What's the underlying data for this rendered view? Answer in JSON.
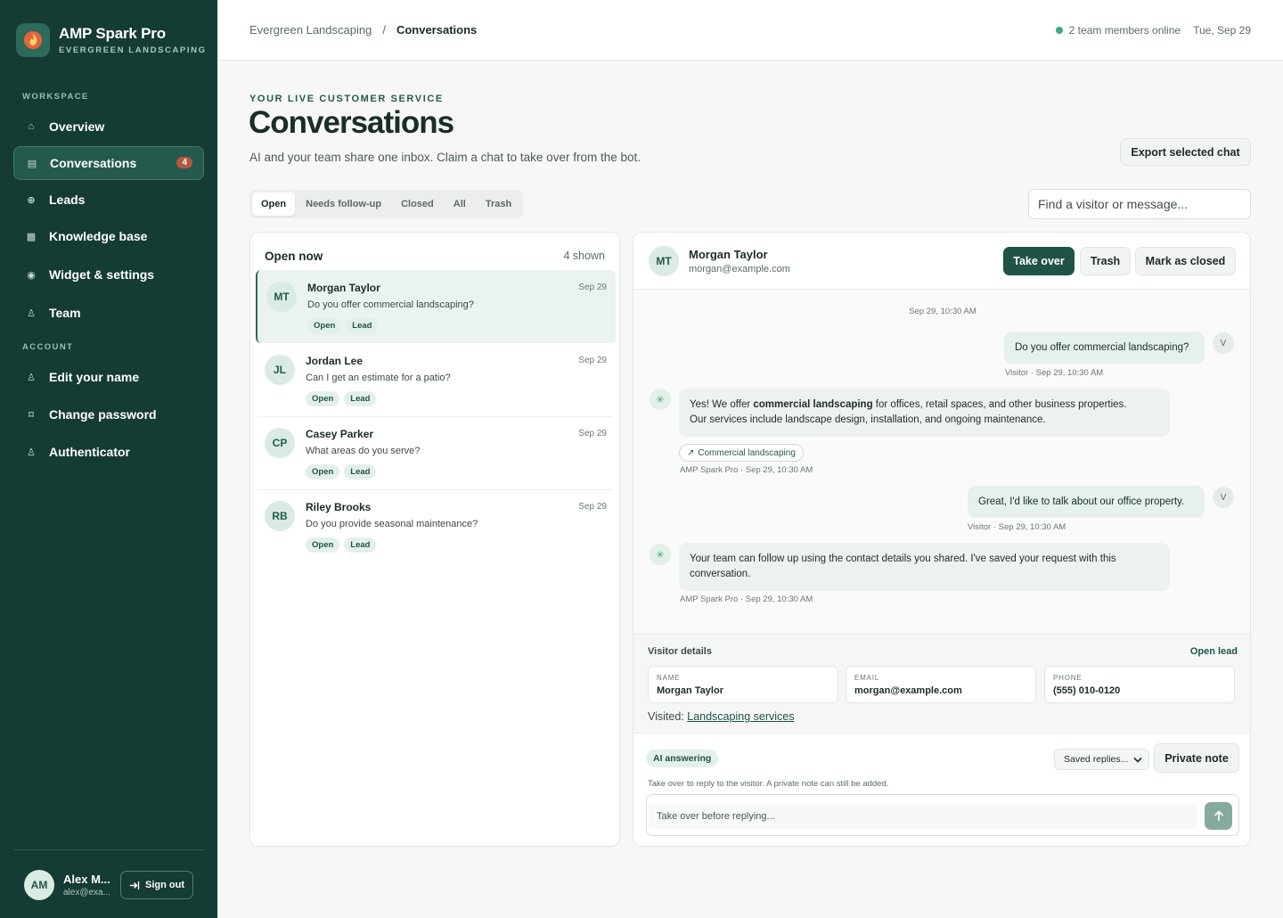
{
  "brand": {
    "name": "AMP Spark Pro",
    "subtitle": "EVERGREEN LANDSCAPING"
  },
  "sidebar": {
    "workspace_label": "WORKSPACE",
    "account_label": "ACCOUNT",
    "workspace_items": [
      {
        "label": "Overview",
        "icon": "home-icon"
      },
      {
        "label": "Conversations",
        "icon": "chat-list-icon",
        "badge": "4",
        "active": true
      },
      {
        "label": "Leads",
        "icon": "target-icon"
      },
      {
        "label": "Knowledge base",
        "icon": "book-icon"
      },
      {
        "label": "Widget & settings",
        "icon": "widget-icon"
      },
      {
        "label": "Team",
        "icon": "team-icon"
      }
    ],
    "account_items": [
      {
        "label": "Edit your name",
        "icon": "person-icon"
      },
      {
        "label": "Change password",
        "icon": "lock-icon"
      },
      {
        "label": "Authenticator",
        "icon": "shield-icon"
      }
    ],
    "user": {
      "initials": "AM",
      "name": "Alex M...",
      "email": "alex@exa..."
    },
    "signout_label": "Sign out"
  },
  "topbar": {
    "crumb_root": "Evergreen Landscaping",
    "crumb_sep": "/",
    "crumb_current": "Conversations",
    "online": "2 team members online",
    "date": "Tue, Sep 29"
  },
  "header": {
    "eyebrow": "YOUR LIVE CUSTOMER SERVICE",
    "title": "Conversations",
    "subtitle": "AI and your team share one inbox. Claim a chat to take over from the bot.",
    "export_label": "Export selected chat"
  },
  "tabs": [
    {
      "label": "Open",
      "active": true
    },
    {
      "label": "Needs follow-up"
    },
    {
      "label": "Closed"
    },
    {
      "label": "All"
    },
    {
      "label": "Trash"
    }
  ],
  "search": {
    "placeholder": "Find a visitor or message..."
  },
  "list": {
    "title": "Open now",
    "count": "4 shown",
    "conversations": [
      {
        "initials": "MT",
        "name": "Morgan Taylor",
        "date": "Sep 29",
        "preview": "Do you offer commercial landscaping?",
        "tags": [
          "Open",
          "Lead"
        ],
        "selected": true
      },
      {
        "initials": "JL",
        "name": "Jordan Lee",
        "date": "Sep 29",
        "preview": "Can I get an estimate for a patio?",
        "tags": [
          "Open",
          "Lead"
        ]
      },
      {
        "initials": "CP",
        "name": "Casey Parker",
        "date": "Sep 29",
        "preview": "What areas do you serve?",
        "tags": [
          "Open",
          "Lead"
        ]
      },
      {
        "initials": "RB",
        "name": "Riley Brooks",
        "date": "Sep 29",
        "preview": "Do you provide seasonal maintenance?",
        "tags": [
          "Open",
          "Lead"
        ]
      }
    ]
  },
  "chat": {
    "contact": {
      "initials": "MT",
      "name": "Morgan Taylor",
      "email": "morgan@example.com"
    },
    "actions": {
      "take_over": "Take over",
      "trash": "Trash",
      "close": "Mark as closed"
    },
    "day_stamp": "Sep 29, 10:30 AM",
    "messages": [
      {
        "from": "visitor",
        "badge": "V",
        "text": "Do you offer commercial landscaping?",
        "meta": "Visitor · Sep 29, 10:30 AM"
      },
      {
        "from": "bot",
        "badge": "✳",
        "text_pre": "Yes! We offer ",
        "text_bold": "commercial landscaping",
        "text_post": " for offices, retail spaces, and other business properties.",
        "text_line2": "Our services include landscape design, installation, and ongoing maintenance.",
        "source": "Commercial landscaping",
        "meta": "AMP Spark Pro · Sep 29, 10:30 AM"
      },
      {
        "from": "visitor",
        "badge": "V",
        "text": "Great, I'd like to talk about our office property.",
        "meta": "Visitor · Sep 29, 10:30 AM"
      },
      {
        "from": "bot",
        "badge": "✳",
        "text_line1": "Your team can follow up using the contact details you shared. I've saved your request with this",
        "text_line2": "conversation.",
        "meta": "AMP Spark Pro · Sep 29, 10:30 AM"
      }
    ],
    "details": {
      "title": "Visitor details",
      "open_lead": "Open lead",
      "name_label": "NAME",
      "name": "Morgan Taylor",
      "email_label": "EMAIL",
      "email": "morgan@example.com",
      "phone_label": "PHONE",
      "phone": "(555) 010-0120",
      "visited_label": "Visited:",
      "visited_link": "Landscaping services"
    },
    "composer": {
      "status": "AI answering",
      "saved_replies": "Saved replies...",
      "private_note": "Private note",
      "helper": "Take over to reply to the visitor. A private note can still be added.",
      "placeholder": "Take over before replying..."
    }
  },
  "colors": {
    "sidebar": "#143b34",
    "accent": "#1e5346",
    "badge": "#b5573c",
    "online": "#3fa878"
  }
}
